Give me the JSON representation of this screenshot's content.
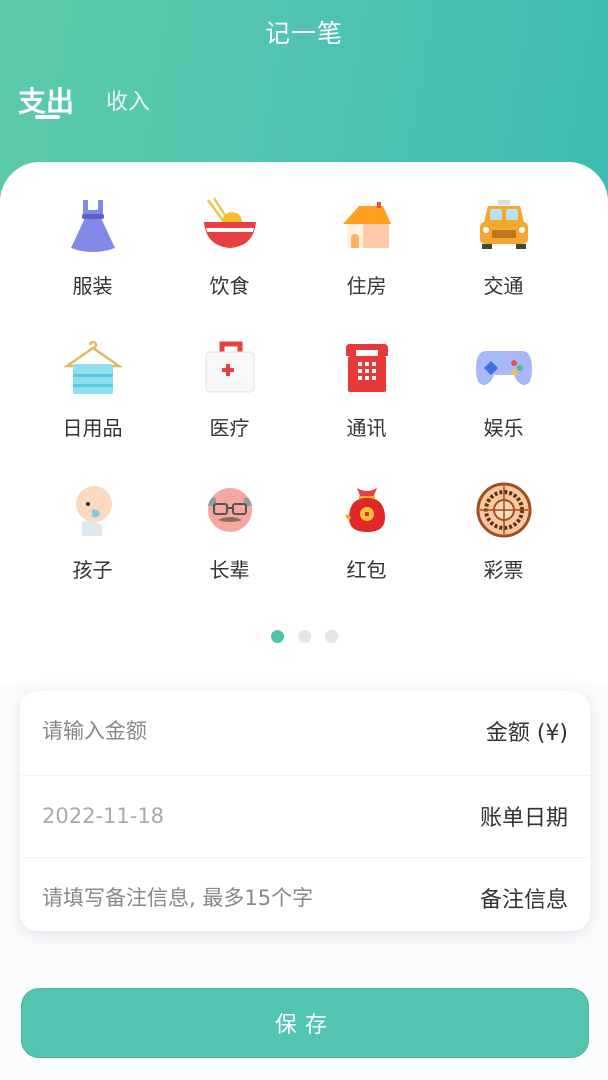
{
  "header": {
    "title": "记一笔",
    "tabs": [
      {
        "label": "支出",
        "active": true
      },
      {
        "label": "收入",
        "active": false
      }
    ]
  },
  "categories": [
    {
      "label": "服装",
      "icon": "dress-icon"
    },
    {
      "label": "饮食",
      "icon": "noodle-bowl-icon"
    },
    {
      "label": "住房",
      "icon": "house-icon"
    },
    {
      "label": "交通",
      "icon": "taxi-icon"
    },
    {
      "label": "日用品",
      "icon": "towel-hanger-icon"
    },
    {
      "label": "医疗",
      "icon": "first-aid-kit-icon"
    },
    {
      "label": "通讯",
      "icon": "telephone-icon"
    },
    {
      "label": "娱乐",
      "icon": "gamepad-icon"
    },
    {
      "label": "孩子",
      "icon": "baby-icon"
    },
    {
      "label": "长辈",
      "icon": "elder-icon"
    },
    {
      "label": "红包",
      "icon": "red-envelope-bag-icon"
    },
    {
      "label": "彩票",
      "icon": "lottery-wheel-icon"
    }
  ],
  "pager": {
    "pages": 3,
    "current": 1
  },
  "form": {
    "amount": {
      "placeholder": "请输入金额",
      "value": "",
      "label": "金额 (¥)"
    },
    "date": {
      "value": "2022-11-18",
      "label": "账单日期"
    },
    "note": {
      "placeholder": "请填写备注信息, 最多15个字",
      "value": "",
      "label": "备注信息"
    }
  },
  "save_label": "保存",
  "colors": {
    "accent": "#52c5b0",
    "header_start": "#5ccba9",
    "header_end": "#3dbcb2"
  }
}
